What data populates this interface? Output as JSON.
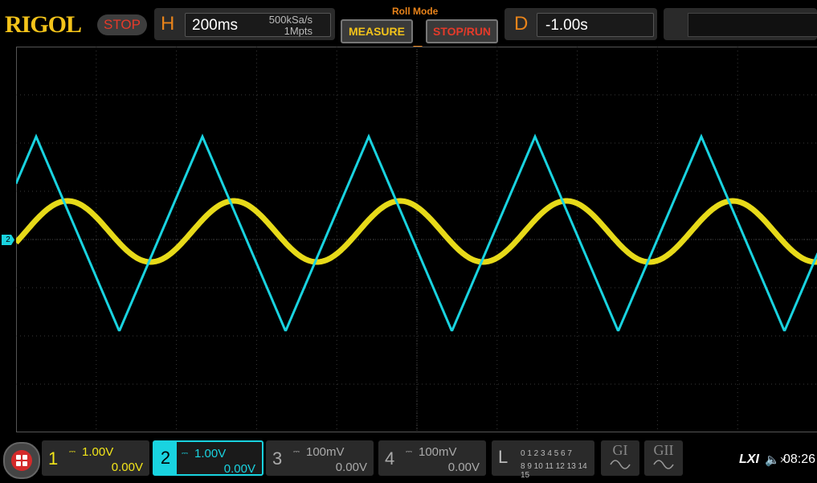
{
  "header": {
    "brand": "RIGOL",
    "run_state": "STOP",
    "horizontal": {
      "letter": "H",
      "timebase": "200ms",
      "sample_rate": "500kSa/s",
      "memory_depth": "1Mpts"
    },
    "roll_mode": "Roll Mode",
    "measure_label": "MEASURE",
    "stop_run_label": "STOP/RUN",
    "delay": {
      "letter": "D",
      "value": "-1.00s"
    }
  },
  "channels": [
    {
      "num": "1",
      "scale": "1.00V",
      "offset": "0.00V",
      "color": "#f3e61a"
    },
    {
      "num": "2",
      "scale": "1.00V",
      "offset": "0.00V",
      "color": "#19d3e0"
    },
    {
      "num": "3",
      "scale": "100mV",
      "offset": "0.00V",
      "color": "#aaaaaa"
    },
    {
      "num": "4",
      "scale": "100mV",
      "offset": "0.00V",
      "color": "#aaaaaa"
    }
  ],
  "ch2_marker": "2",
  "logic": {
    "letter": "L",
    "row1": "0 1 2 3  4 5 6 7",
    "row2": "8 9 10 11 12 13 14 15"
  },
  "generators": {
    "g1": "GI",
    "g2": "GII"
  },
  "status": {
    "lxi": "LXI",
    "speaker": "🔈×",
    "time": "08:26"
  },
  "icons": [
    "menu-icon",
    "coupling-dc-icon",
    "sine-wave-icon",
    "speaker-muted-icon"
  ],
  "waveforms": {
    "ch1": {
      "shape": "sine",
      "periods_on_screen": 4.8
    },
    "ch2": {
      "shape": "triangle",
      "periods_on_screen": 4.8
    }
  }
}
